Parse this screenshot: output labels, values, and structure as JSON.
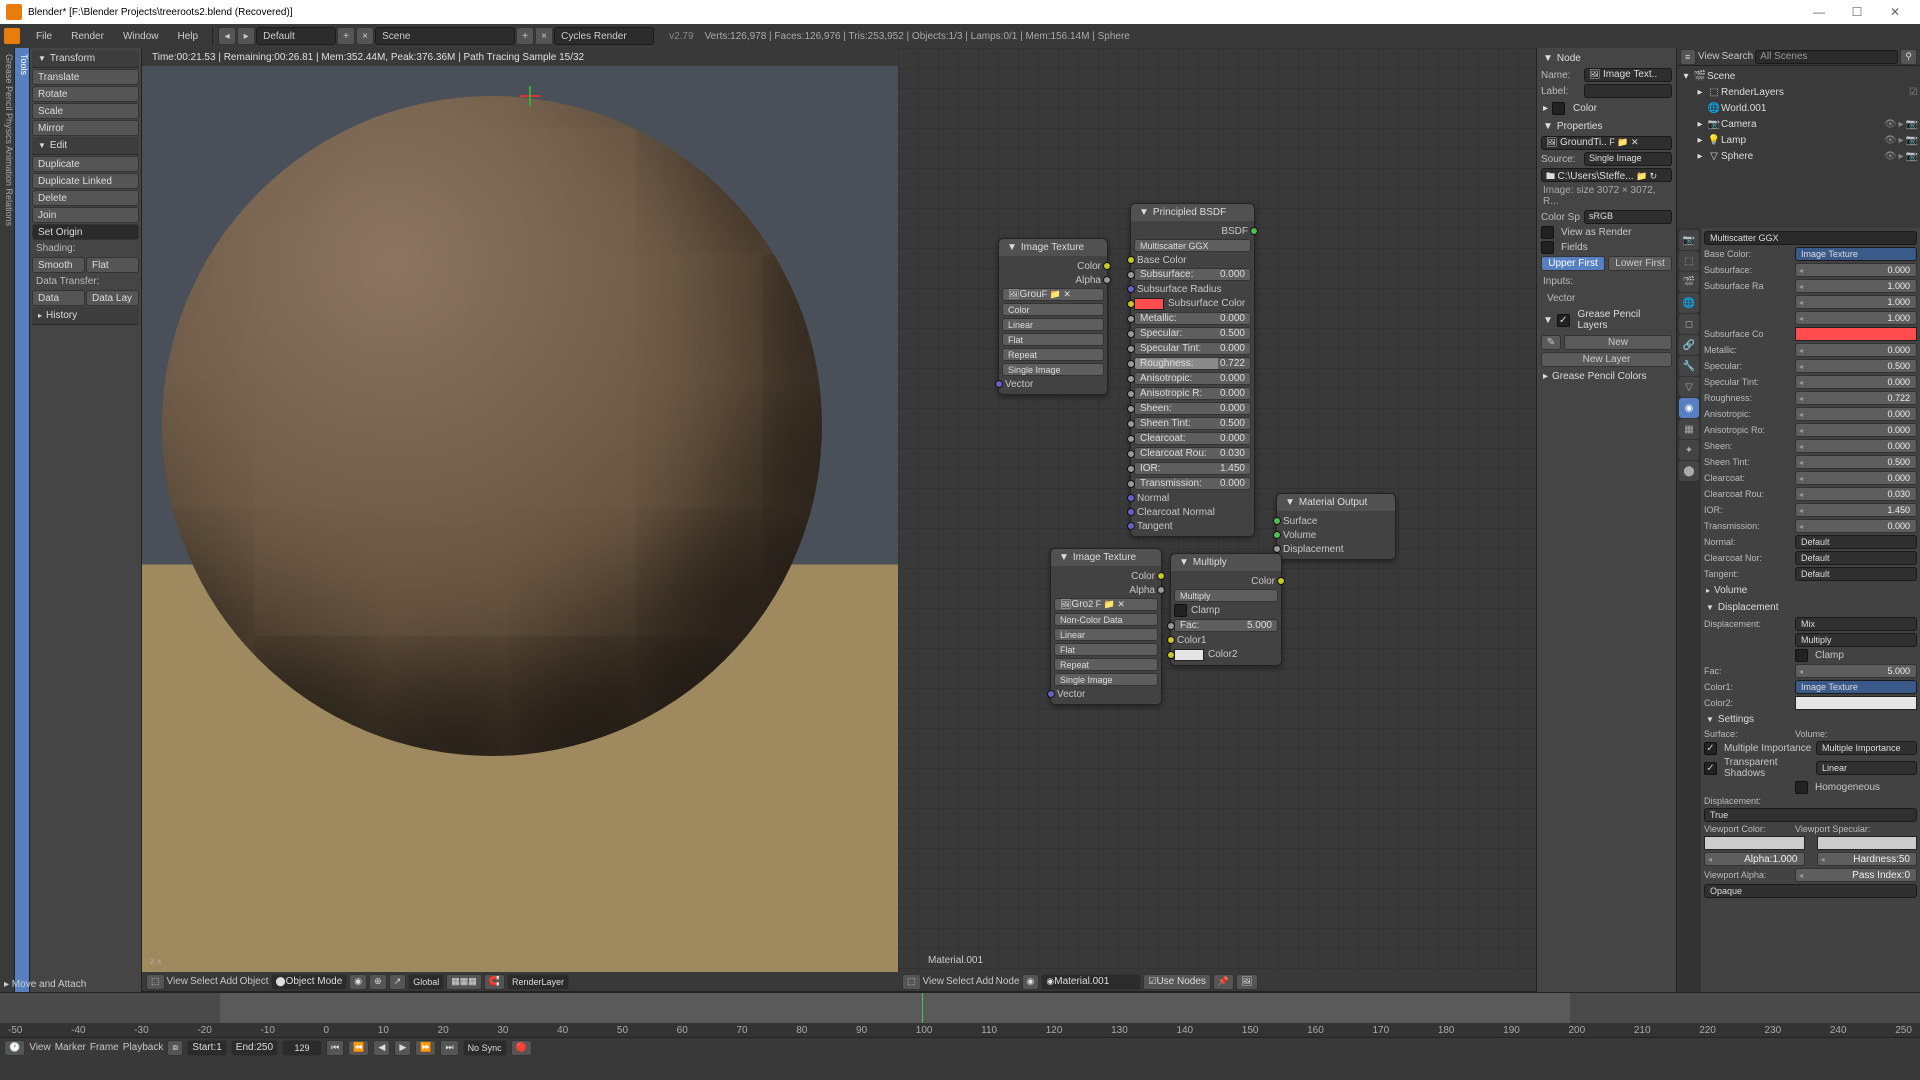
{
  "titlebar": {
    "title": "Blender* [F:\\Blender Projects\\treeroots2.blend (Recovered)]",
    "min": "—",
    "max": "☐",
    "close": "✕"
  },
  "menubar": {
    "file": "File",
    "render": "Render",
    "window": "Window",
    "help": "Help",
    "layout": "Default",
    "add": "+",
    "close": "×",
    "scene": "Scene",
    "engine": "Cycles Render",
    "version": "v2.79",
    "stats": "Verts:126,978 | Faces:126,976 | Tris:253,952 | Objects:1/3 | Lamps:0/1 | Mem:156.14M | Sphere"
  },
  "rail1": "Grease Pencil  Physics  Animation  Relations",
  "rail2": "Tools",
  "toolshelf": {
    "transform": "Transform",
    "translate": "Translate",
    "rotate": "Rotate",
    "scale": "Scale",
    "mirror": "Mirror",
    "edit": "Edit",
    "duplicate": "Duplicate",
    "duplinked": "Duplicate Linked",
    "delete": "Delete",
    "join": "Join",
    "setorigin": "Set Origin",
    "shading": "Shading:",
    "smooth": "Smooth",
    "flat": "Flat",
    "datatransfer": "Data Transfer:",
    "data": "Data",
    "datalay": "Data Lay",
    "history": "History"
  },
  "viewport": {
    "status": "Time:00:21.53 | Remaining:00:26.81 | Mem:352.44M, Peak:376.36M | Path Tracing Sample 15/32",
    "axis": "z\n   x",
    "header": {
      "view": "View",
      "select": "Select",
      "add": "Add",
      "object": "Object",
      "mode": "Object Mode",
      "shading": "Global",
      "layer": "RenderLayer"
    }
  },
  "lastop": " ▸ Move and Attach",
  "node_editor": {
    "matname": "Material.001",
    "header": {
      "view": "View",
      "select": "Select",
      "add": "Add",
      "node": "Node",
      "mat": "Material.001",
      "use": "Use Nodes"
    },
    "img_tex1": {
      "title": "Image Texture",
      "color": "Color",
      "alpha": "Alpha",
      "img": "Grou",
      "colorspace": "Color",
      "interp": "Linear",
      "proj": "Flat",
      "ext": "Repeat",
      "src": "Single Image",
      "vector": "Vector"
    },
    "principled": {
      "title": "Principled BSDF",
      "bsdf": "BSDF",
      "dist": "Multiscatter GGX",
      "basecolor": "Base Color",
      "subsurface": "Subsurface:",
      "subsurface_v": "0.000",
      "subrad": "Subsurface Radius",
      "subcol": "Subsurface Color",
      "metallic": "Metallic:",
      "metallic_v": "0.000",
      "specular": "Specular:",
      "specular_v": "0.500",
      "spectint": "Specular Tint:",
      "spectint_v": "0.000",
      "rough": "Roughness:",
      "rough_v": "0.722",
      "aniso": "Anisotropic:",
      "aniso_v": "0.000",
      "anisor": "Anisotropic R:",
      "anisor_v": "0.000",
      "sheen": "Sheen:",
      "sheen_v": "0.000",
      "sheentint": "Sheen Tint:",
      "sheentint_v": "0.500",
      "clearcoat": "Clearcoat:",
      "clearcoat_v": "0.000",
      "clearrough": "Clearcoat Rou:",
      "clearrough_v": "0.030",
      "ior": "IOR:",
      "ior_v": "1.450",
      "trans": "Transmission:",
      "trans_v": "0.000",
      "normal": "Normal",
      "cnormal": "Clearcoat Normal",
      "tangent": "Tangent"
    },
    "mat_out": {
      "title": "Material Output",
      "surface": "Surface",
      "volume": "Volume",
      "disp": "Displacement"
    },
    "img_tex2": {
      "title": "Image Texture",
      "color": "Color",
      "alpha": "Alpha",
      "img": "Gro",
      "colorspace": "Non-Color Data",
      "interp": "Linear",
      "proj": "Flat",
      "ext": "Repeat",
      "src": "Single Image",
      "vector": "Vector"
    },
    "multiply": {
      "title": "Multiply",
      "color": "Color",
      "blend": "Multiply",
      "clamp": "Clamp",
      "fac": "Fac:",
      "fac_v": "5.000",
      "color1": "Color1",
      "color2": "Color2"
    }
  },
  "npanel": {
    "node": "Node",
    "name": "Name:",
    "name_v": "Image Text..",
    "label": "Label:",
    "color": "Color",
    "props": "Properties",
    "img": "GroundTi..",
    "source": "Source:",
    "source_v": "Single Image",
    "filepath": "C:\\Users\\Steffe...",
    "imgsize": "Image: size 3072 × 3072, R...",
    "colorsp": "Color Sp",
    "colorsp_v": "sRGB",
    "viewrender": "View as Render",
    "fields": "Fields",
    "upper": "Upper First",
    "lower": "Lower First",
    "inputs": "Inputs:",
    "vector": "Vector",
    "gp": "Grease Pencil Layers",
    "new": "New",
    "newlayer": "New Layer",
    "gpc": "Grease Pencil Colors"
  },
  "outliner": {
    "view": "View",
    "search": "Search",
    "filter": "All Scenes",
    "scene": "Scene",
    "rl": "RenderLayers",
    "world": "World.001",
    "camera": "Camera",
    "lamp": "Lamp",
    "sphere": "Sphere",
    "eye": "👁",
    "sel": "▸",
    "rend": "📷"
  },
  "props": {
    "dist": "Multiscatter GGX",
    "basecolor": "Base Color:",
    "basecolor_v": "Image Texture",
    "subsurface": "Subsurface:",
    "subsurface_v": "0.000",
    "subrad": "Subsurface Ra",
    "subrad_v1": "1.000",
    "subrad_v2": "1.000",
    "subrad_v3": "1.000",
    "subcol": "Subsurface Co",
    "metallic": "Metallic:",
    "metallic_v": "0.000",
    "specular": "Specular:",
    "specular_v": "0.500",
    "spectint": "Specular Tint:",
    "spectint_v": "0.000",
    "rough": "Roughness:",
    "rough_v": "0.722",
    "aniso": "Anisotropic:",
    "aniso_v": "0.000",
    "anisor": "Anisotropic Ro:",
    "anisor_v": "0.000",
    "sheen": "Sheen:",
    "sheen_v": "0.000",
    "sheentint": "Sheen Tint:",
    "sheentint_v": "0.500",
    "clearcoat": "Clearcoat:",
    "clearcoat_v": "0.000",
    "clearrough": "Clearcoat Rou:",
    "clearrough_v": "0.030",
    "ior": "IOR:",
    "ior_v": "1.450",
    "trans": "Transmission:",
    "trans_v": "0.000",
    "normal": "Normal:",
    "normal_v": "Default",
    "cnormal": "Clearcoat Nor:",
    "cnormal_v": "Default",
    "tangent": "Tangent:",
    "tangent_v": "Default",
    "volume": "Volume",
    "displacement": "Displacement",
    "disp": "Displacement:",
    "disp_v": "Mix",
    "mul": "Multiply",
    "clamp": "Clamp",
    "fac": "Fac:",
    "fac_v": "5.000",
    "color1": "Color1:",
    "color1_v": "Image Texture",
    "color2": "Color2:",
    "settings": "Settings",
    "surface": "Surface:",
    "volume2": "Volume:",
    "mis": "Multiple Importance",
    "mis2": "Multiple Importance",
    "tshadows": "Transparent Shadows",
    "interp": "Linear",
    "homo": "Homogeneous",
    "disp2": "Displacement:",
    "disp2_v": "True",
    "vcolor": "Viewport Color:",
    "vspec": "Viewport Specular:",
    "alpha": "Alpha:",
    "alpha_v": "1.000",
    "hard": "Hardness:",
    "hard_v": "50",
    "valpha": "Viewport Alpha:",
    "passidx": "Pass Index:",
    "passidx_v": "0",
    "opaque": "Opaque"
  },
  "timeline": {
    "ticks": [
      "-50",
      "-40",
      "-30",
      "-20",
      "-10",
      "0",
      "10",
      "20",
      "30",
      "40",
      "50",
      "60",
      "70",
      "80",
      "90",
      "100",
      "110",
      "120",
      "130",
      "140",
      "150",
      "160",
      "170",
      "180",
      "190",
      "200",
      "210",
      "220",
      "230",
      "240",
      "250"
    ],
    "view": "View",
    "marker": "Marker",
    "frame": "Frame",
    "playback": "Playback",
    "start": "Start:",
    "start_v": "1",
    "end": "End:",
    "end_v": "250",
    "cur": "129",
    "sync": "No Sync"
  }
}
